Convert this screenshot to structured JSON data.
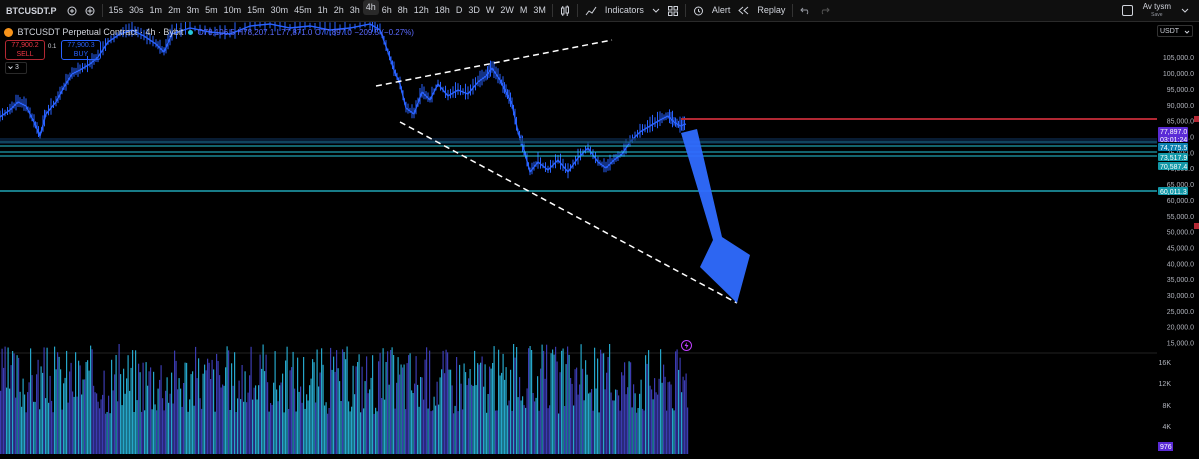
{
  "toolbar": {
    "symbol": "BTCUSDT.P",
    "timeframes": [
      "15s",
      "30s",
      "1m",
      "2m",
      "3m",
      "5m",
      "10m",
      "15m",
      "30m",
      "45m",
      "1h",
      "2h",
      "3h",
      "4h",
      "6h",
      "8h",
      "12h",
      "18h",
      "D",
      "3D",
      "W",
      "2W",
      "M",
      "3M"
    ],
    "active_timeframe": "4h",
    "indicators_label": "Indicators",
    "alert_label": "Alert",
    "replay_label": "Replay",
    "layout_name": "Av tysm",
    "layout_status": "Save"
  },
  "legend": {
    "title": "BTCUSDT Perpetual Contract · 4h · Bybit",
    "o": "O78,106.5",
    "h": "H78,207.1",
    "l": "L77,871.0",
    "c": "C77,897.0",
    "chg": "−209.5 (−0.27%)",
    "sell_price": "77,900.2",
    "sell_label": "SELL",
    "spread": "0.1",
    "buy_price": "77,900.3",
    "buy_label": "BUY",
    "indicator_count": "3"
  },
  "currency": "USDT",
  "price_axis": {
    "labels": [
      "105,000.0",
      "100,000.0",
      "95,000.0",
      "90,000.0",
      "85,000.0",
      "80,000.0",
      "75,000.0",
      "70,000.0",
      "65,000.0",
      "60,000.0",
      "55,000.0",
      "50,000.0",
      "45,000.0",
      "40,000.0",
      "35,000.0",
      "30,000.0",
      "25,000.0",
      "20,000.0",
      "15,000.0"
    ],
    "values": [
      105000,
      100000,
      95000,
      90000,
      85000,
      80000,
      75000,
      70000,
      65000,
      60000,
      55000,
      50000,
      45000,
      40000,
      35000,
      30000,
      25000,
      20000,
      15000
    ]
  },
  "price_tags": {
    "current_price": "77,897.0",
    "countdown": "03:01:24",
    "level1": "74,775.5",
    "level2": "73,517.9",
    "level3": "70,587.4",
    "level4": "60,011.3"
  },
  "volume_axis": {
    "labels": [
      "16K",
      "12K",
      "8K",
      "4K"
    ],
    "current_volume": "976"
  },
  "colors": {
    "background": "#000000",
    "candle": "#2962ff",
    "level_line": "#26c6da",
    "resistance": "#b22833",
    "arrow": "#2f6bff",
    "current_tag": "#5b2bd6",
    "volume_a": "#26a6c9",
    "volume_b": "#3b3bb0"
  }
}
